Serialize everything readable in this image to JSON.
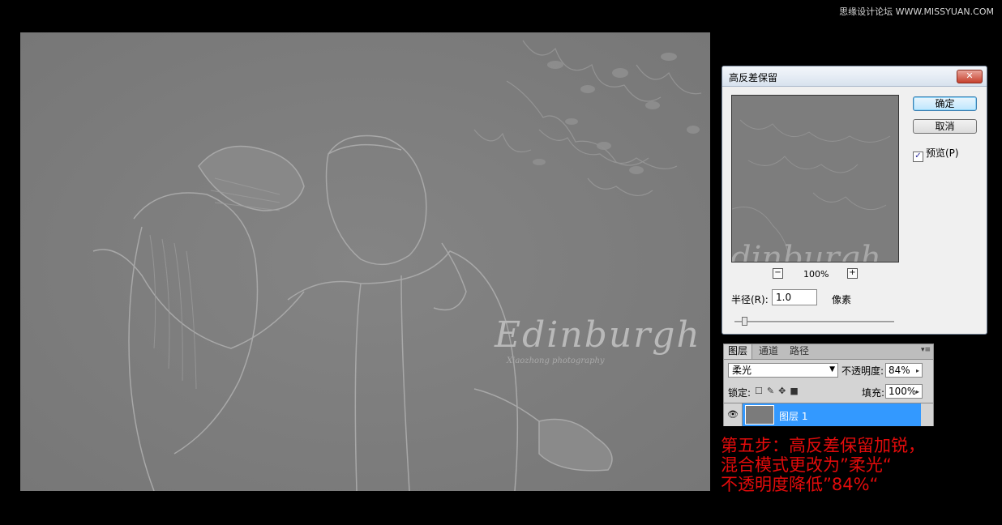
{
  "watermark": "思缘设计论坛 WWW.MISSYUAN.COM",
  "canvas": {
    "title_script": "Edinburgh",
    "subtitle_script": "Xiaozhong photography"
  },
  "dialog": {
    "title": "高反差保留",
    "close_icon": "close-icon",
    "ok_label": "确定",
    "cancel_label": "取消",
    "preview_label": "预览(P)",
    "preview_checked": true,
    "preview_text": "dinburgh",
    "zoom_minus": "−",
    "zoom_plus": "+",
    "zoom_level": "100%",
    "radius_label": "半径(R):",
    "radius_value": "1.0",
    "radius_unit": "像素"
  },
  "layers_panel": {
    "tabs": [
      "图层",
      "通道",
      "路径"
    ],
    "active_tab": "图层",
    "menu_icon": "panel-menu-icon",
    "blend_mode": "柔光",
    "opacity_label": "不透明度:",
    "opacity_value": "84%",
    "lock_label": "锁定:",
    "fill_label": "填充:",
    "fill_value": "100%",
    "layer_name": "图层 1",
    "selection_color": "#3399ff"
  },
  "annotation": {
    "color": "#e30b0b",
    "lines": [
      "第五步：高反差保留加锐，",
      "混合模式更改为”柔光“",
      "不透明度降低”84%“"
    ]
  }
}
